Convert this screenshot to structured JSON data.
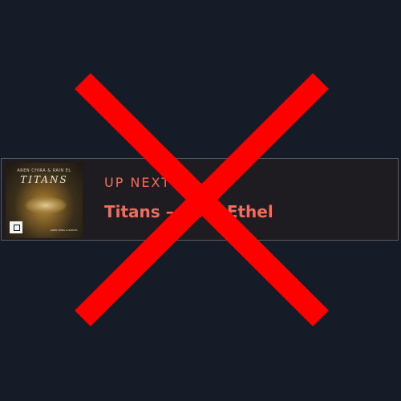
{
  "up_next": {
    "label": "UP NEXT",
    "track_title": "Titans – Rezz Ethel",
    "artwork": {
      "title": "TITANS",
      "artists": "AREN CHIRA & RAIN EL",
      "credit": "AREN CHIRA & RAIN EL"
    }
  },
  "colors": {
    "background": "#151b27",
    "card": "#1e1b21",
    "accent": "#f26d5b",
    "cross": "#ff0000"
  },
  "icons": {
    "overlay": "close-x-icon",
    "label_logo": "monstercat-logo-icon"
  }
}
